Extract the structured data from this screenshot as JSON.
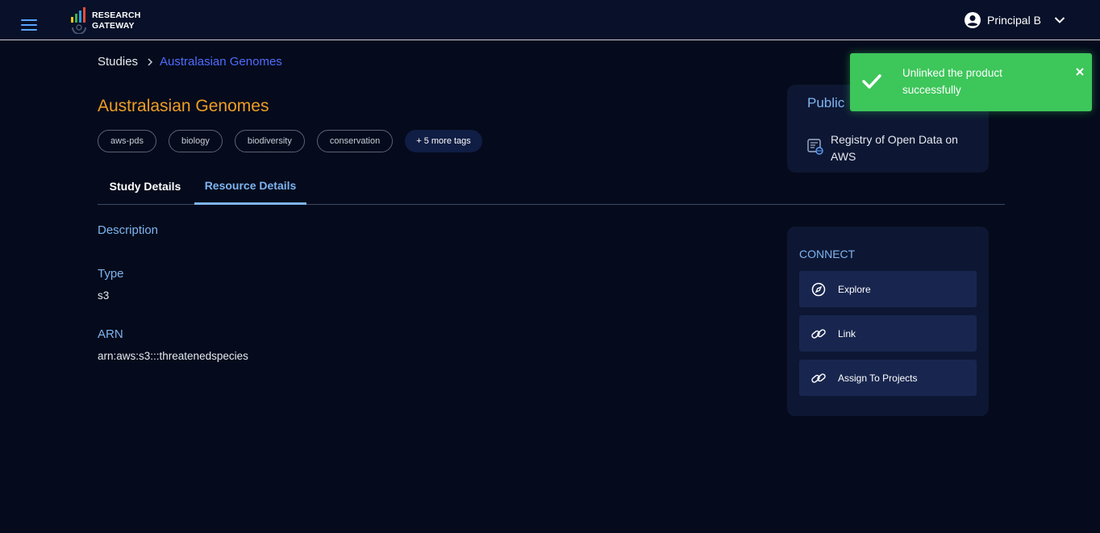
{
  "header": {
    "logo_line1": "RESEARCH",
    "logo_line2": "GATEWAY",
    "user_name": "Principal B"
  },
  "breadcrumb": {
    "root": "Studies",
    "current": "Australasian Genomes"
  },
  "study": {
    "title": "Australasian Genomes",
    "tags": [
      "aws-pds",
      "biology",
      "biodiversity",
      "conservation"
    ],
    "more_tags": "+ 5 more tags"
  },
  "tabs": [
    {
      "label": "Study Details",
      "active": false
    },
    {
      "label": "Resource Details",
      "active": true
    }
  ],
  "details": {
    "description_label": "Description",
    "description_value": "",
    "type_label": "Type",
    "type_value": "s3",
    "arn_label": "ARN",
    "arn_value": "arn:aws:s3:::threatenedspecies"
  },
  "public_card": {
    "title": "Public",
    "source": "Registry of Open Data on AWS"
  },
  "connect": {
    "title": "CONNECT",
    "actions": [
      {
        "label": "Explore",
        "icon": "compass-icon"
      },
      {
        "label": "Link",
        "icon": "link-icon"
      },
      {
        "label": "Assign To Projects",
        "icon": "link-icon"
      }
    ]
  },
  "toast": {
    "message": "Unlinked the product successfully",
    "color": "#3dc65a"
  },
  "colors": {
    "background": "#050b1c",
    "topbar": "#081129",
    "title": "#ef9d24",
    "accent": "#7eb4f0",
    "link": "#4f6bff",
    "card": "#0d1733",
    "button": "#18264f"
  }
}
